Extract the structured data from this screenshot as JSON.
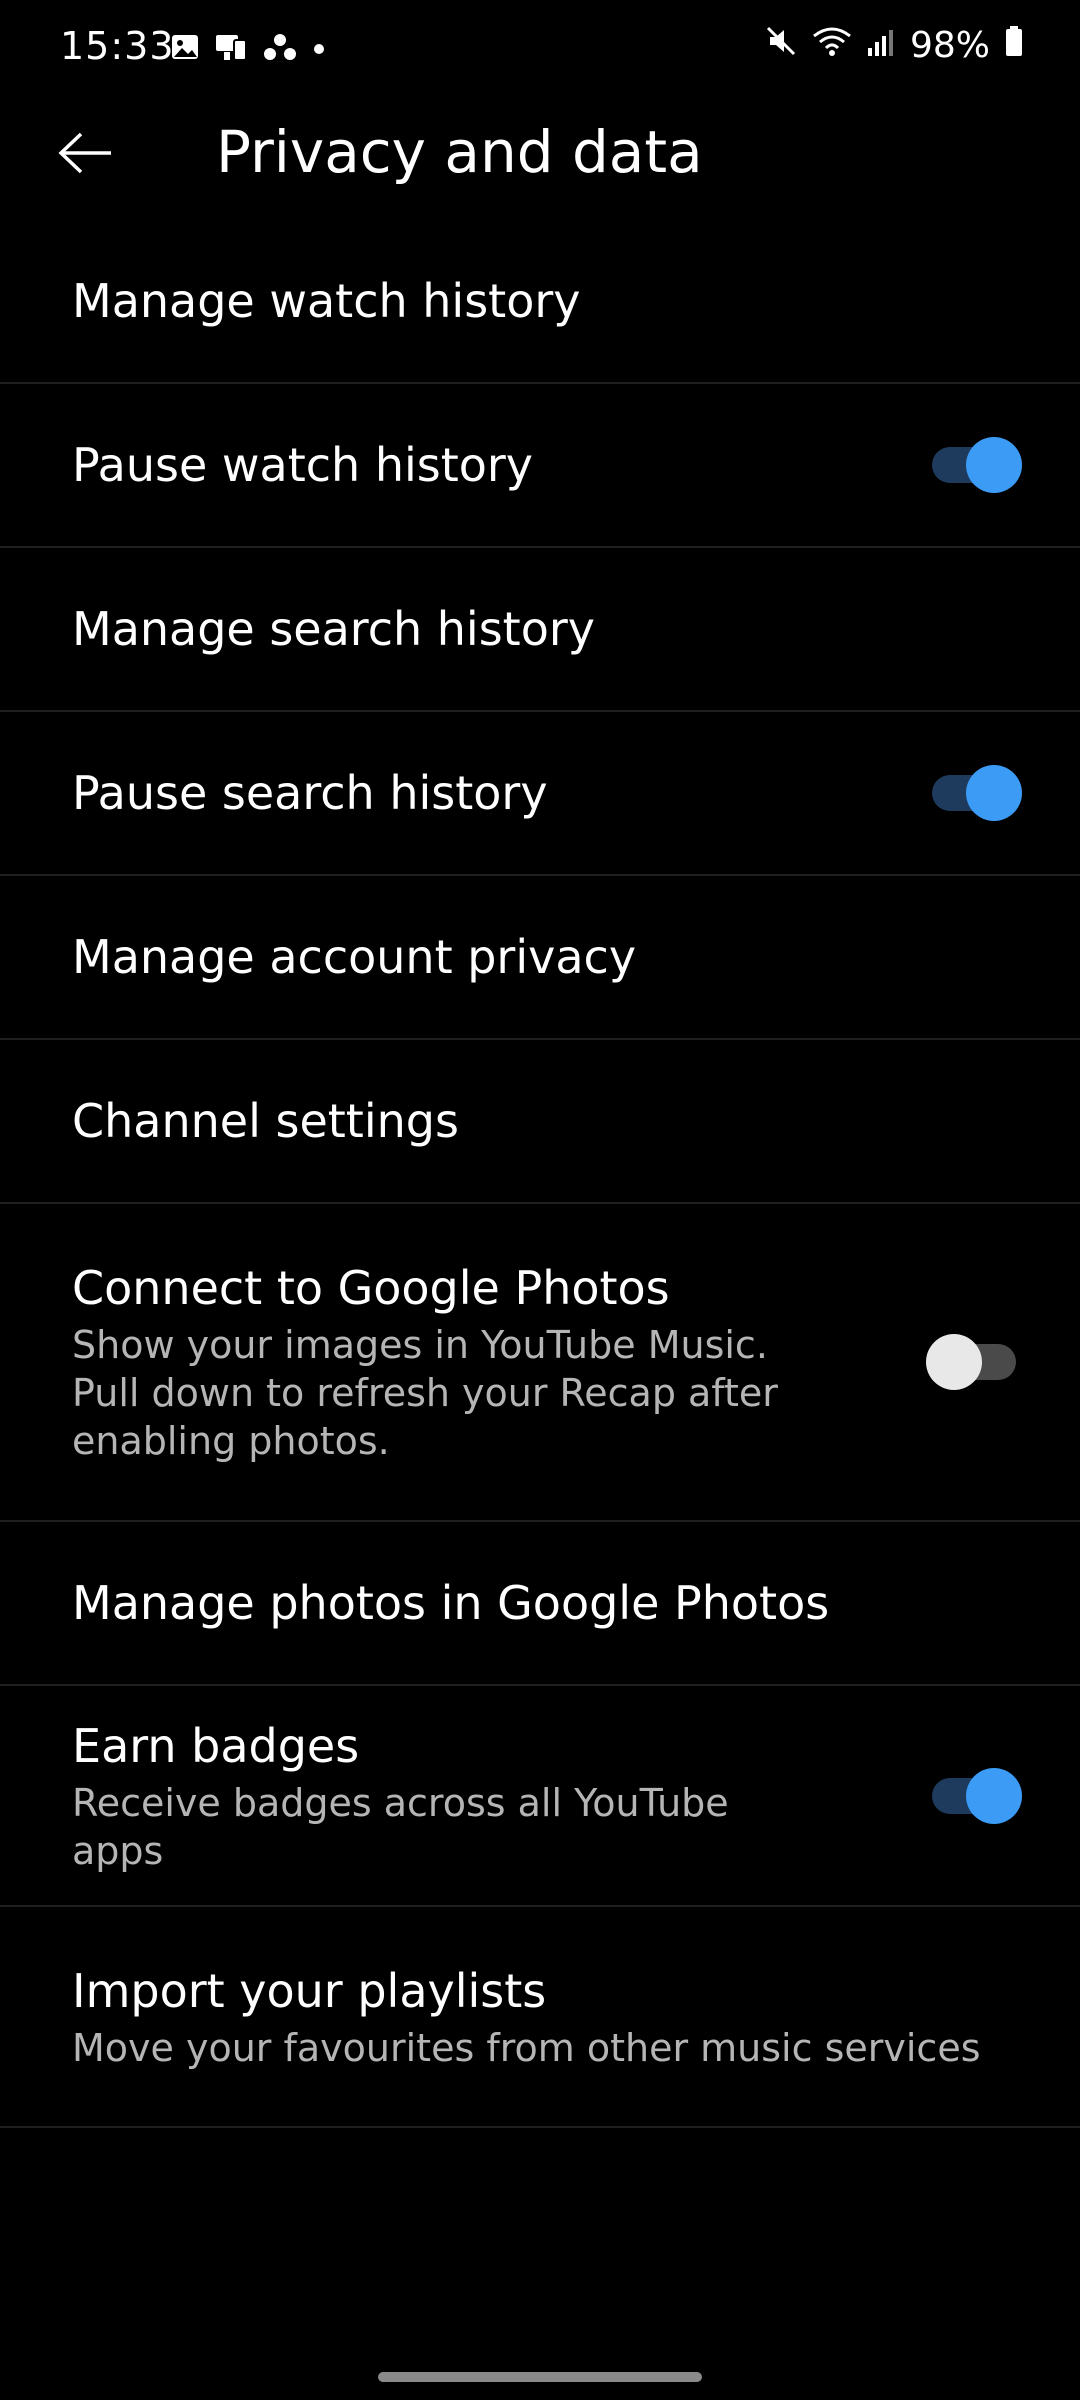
{
  "status_bar": {
    "time": "15:33",
    "battery": "98%",
    "left_icons": [
      "gallery-icon",
      "device-icon",
      "dots-cluster-icon",
      "dot-icon"
    ],
    "right_icons": [
      "mute-icon",
      "wifi-icon",
      "signal-icon",
      "battery-icon"
    ]
  },
  "app_bar": {
    "title": "Privacy and data",
    "back_icon": "arrow-left-icon"
  },
  "settings": [
    {
      "title": "Manage watch history",
      "subtitle": "",
      "toggle": null
    },
    {
      "title": "Pause watch history",
      "subtitle": "",
      "toggle": true
    },
    {
      "title": "Manage search history",
      "subtitle": "",
      "toggle": null
    },
    {
      "title": "Pause search history",
      "subtitle": "",
      "toggle": true
    },
    {
      "title": "Manage account privacy",
      "subtitle": "",
      "toggle": null
    },
    {
      "title": "Channel settings",
      "subtitle": "",
      "toggle": null
    },
    {
      "title": "Connect to Google Photos",
      "subtitle": "Show your images in YouTube Music. Pull down to refresh your Recap after enabling photos.",
      "toggle": false
    },
    {
      "title": "Manage photos in Google Photos",
      "subtitle": "",
      "toggle": null
    },
    {
      "title": "Earn badges",
      "subtitle": "Receive badges across all YouTube apps",
      "toggle": true
    },
    {
      "title": "Import your playlists",
      "subtitle": "Move your favourites from other music services",
      "toggle": null
    }
  ],
  "colors": {
    "background": "#000000",
    "toggle_on_thumb": "#3b9bf5",
    "toggle_on_track": "#1e3a5c",
    "toggle_off_thumb": "#e8e8e8",
    "toggle_off_track": "#4a4a4a",
    "subtitle_text": "#b5b5b5"
  }
}
